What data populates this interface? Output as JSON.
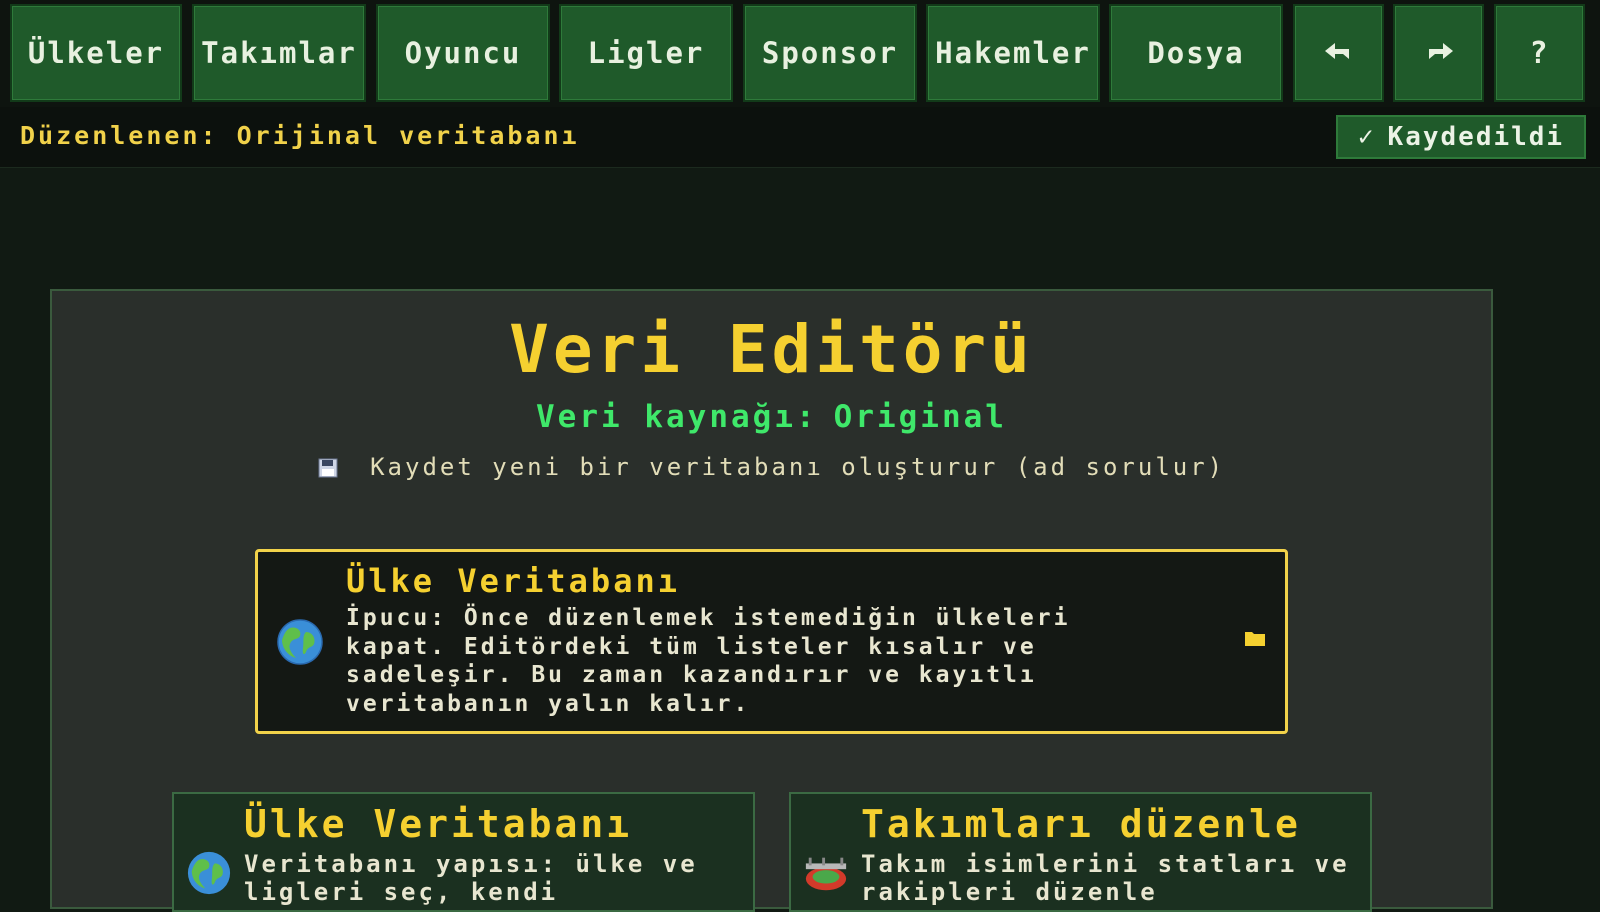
{
  "nav": {
    "countries": "Ülkeler",
    "teams": "Takımlar",
    "player": "Oyuncu",
    "leagues": "Ligler",
    "sponsor": "Sponsor",
    "referees": "Hakemler",
    "file": "Dosya",
    "undo_icon": "undo-icon",
    "redo_icon": "redo-icon",
    "help": "?"
  },
  "status": {
    "editing": "Düzenlenen: Orijinal veritabanı",
    "saved_check": "✓",
    "saved": "Kaydedildi"
  },
  "main": {
    "title": "Veri Editörü",
    "source_label": "Veri kaynağı:",
    "source_value": "Original",
    "save_hint": "Kaydet yeni bir veritabanı oluşturur (ad sorulur)"
  },
  "tip_card": {
    "title": "Ülke Veritabanı",
    "body": "İpucu: Önce düzenlemek istemediğin ülkeleri kapat. Editördeki tüm listeler kısalır ve sadeleşir. Bu zaman kazandırır ve kayıtlı veritabanın yalın kalır.",
    "icon": "globe-icon",
    "action_icon": "folder-icon"
  },
  "cards": [
    {
      "title": "Ülke Veritabanı",
      "body": "Veritabanı yapısı: ülke ve ligleri seç, kendi",
      "icon": "globe-icon"
    },
    {
      "title": "Takımları düzenle",
      "body": "Takım isimlerini statları ve rakipleri düzenle",
      "icon": "stadium-icon"
    }
  ],
  "colors": {
    "accent_yellow": "#f5d030",
    "accent_green": "#3fe86a",
    "button_green": "#1f5a2a",
    "background": "#111a13",
    "panel": "#2a2f2b"
  }
}
